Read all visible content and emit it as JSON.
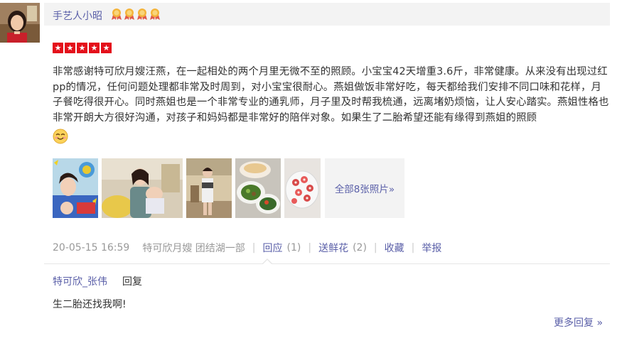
{
  "review": {
    "username": "手艺人小昭",
    "medal_count": 4,
    "rating": 5,
    "text": "非常感谢特可欣月嫂汪燕，在一起相处的两个月里无微不至的照顾。小宝宝42天增重3.6斤，非常健康。从来没有出现过红pp的情况，任何问题处理都非常及时周到，对小宝宝很耐心。燕姐做饭非常好吃，每天都给我们安排不同口味和花样，月子餐吃得很开心。同时燕姐也是一个非常专业的通乳师，月子里及时帮我梳通，远离堵奶烦恼，让人安心踏实。燕姐性格也非常开朗大方很好沟通，对孩子和妈妈都是非常好的陪伴对象。如果生了二胎希望还能有缘得到燕姐的照顾",
    "emoji": "smile-emoji",
    "more_photos_label": "全部8张照片»",
    "meta": {
      "date": "20-05-15 16:59",
      "shop": "特可欣月嫂 团结湖一部",
      "reply_label": "回应",
      "reply_count": "(1)",
      "flower_label": "送鲜花",
      "flower_count": "(2)",
      "favorite_label": "收藏",
      "report_label": "举报"
    }
  },
  "reply": {
    "author": "特可欣_张伟",
    "label": "回复",
    "text": "生二胎还找我啊!",
    "more_label": "更多回复 »"
  },
  "colors": {
    "link": "#5a5fa8",
    "star": "#e4101b",
    "header_bg": "#f3f3f3"
  }
}
